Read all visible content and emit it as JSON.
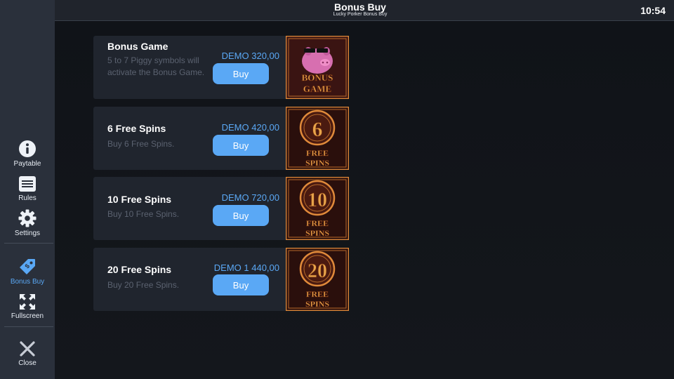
{
  "header": {
    "title": "Bonus Buy",
    "subtitle": "Lucky Porker Bonus Buy",
    "clock": "10:54"
  },
  "sidebar": {
    "items": [
      {
        "label": "Paytable",
        "icon": "info-icon"
      },
      {
        "label": "Rules",
        "icon": "rules-icon"
      },
      {
        "label": "Settings",
        "icon": "gear-icon"
      },
      {
        "label": "Bonus Buy",
        "icon": "tag-icon"
      },
      {
        "label": "Fullscreen",
        "icon": "fullscreen-icon"
      },
      {
        "label": "Close",
        "icon": "close-icon"
      }
    ]
  },
  "cards": [
    {
      "title": "Bonus Game",
      "description": "5 to 7 Piggy symbols will activate the Bonus Game.",
      "price": "DEMO 320,00",
      "button": "Buy",
      "image_text_1": "BONUS",
      "image_text_2": "GAME"
    },
    {
      "title": "6 Free Spins",
      "description": "Buy 6 Free Spins.",
      "price": "DEMO 420,00",
      "button": "Buy",
      "image_number": "6",
      "image_text_1": "FREE",
      "image_text_2": "SPINS"
    },
    {
      "title": "10 Free Spins",
      "description": "Buy 10 Free Spins.",
      "price": "DEMO 720,00",
      "button": "Buy",
      "image_number": "10",
      "image_text_1": "FREE",
      "image_text_2": "SPINS"
    },
    {
      "title": "20 Free Spins",
      "description": "Buy 20 Free Spins.",
      "price": "DEMO 1 440,00",
      "button": "Buy",
      "image_number": "20",
      "image_text_1": "FREE",
      "image_text_2": "SPINS"
    }
  ],
  "colors": {
    "accent": "#5aa8f5",
    "sidebar": "#2a303b",
    "card": "#20252e",
    "gold": "#e08a3a",
    "tile": "#2a0f0c"
  }
}
